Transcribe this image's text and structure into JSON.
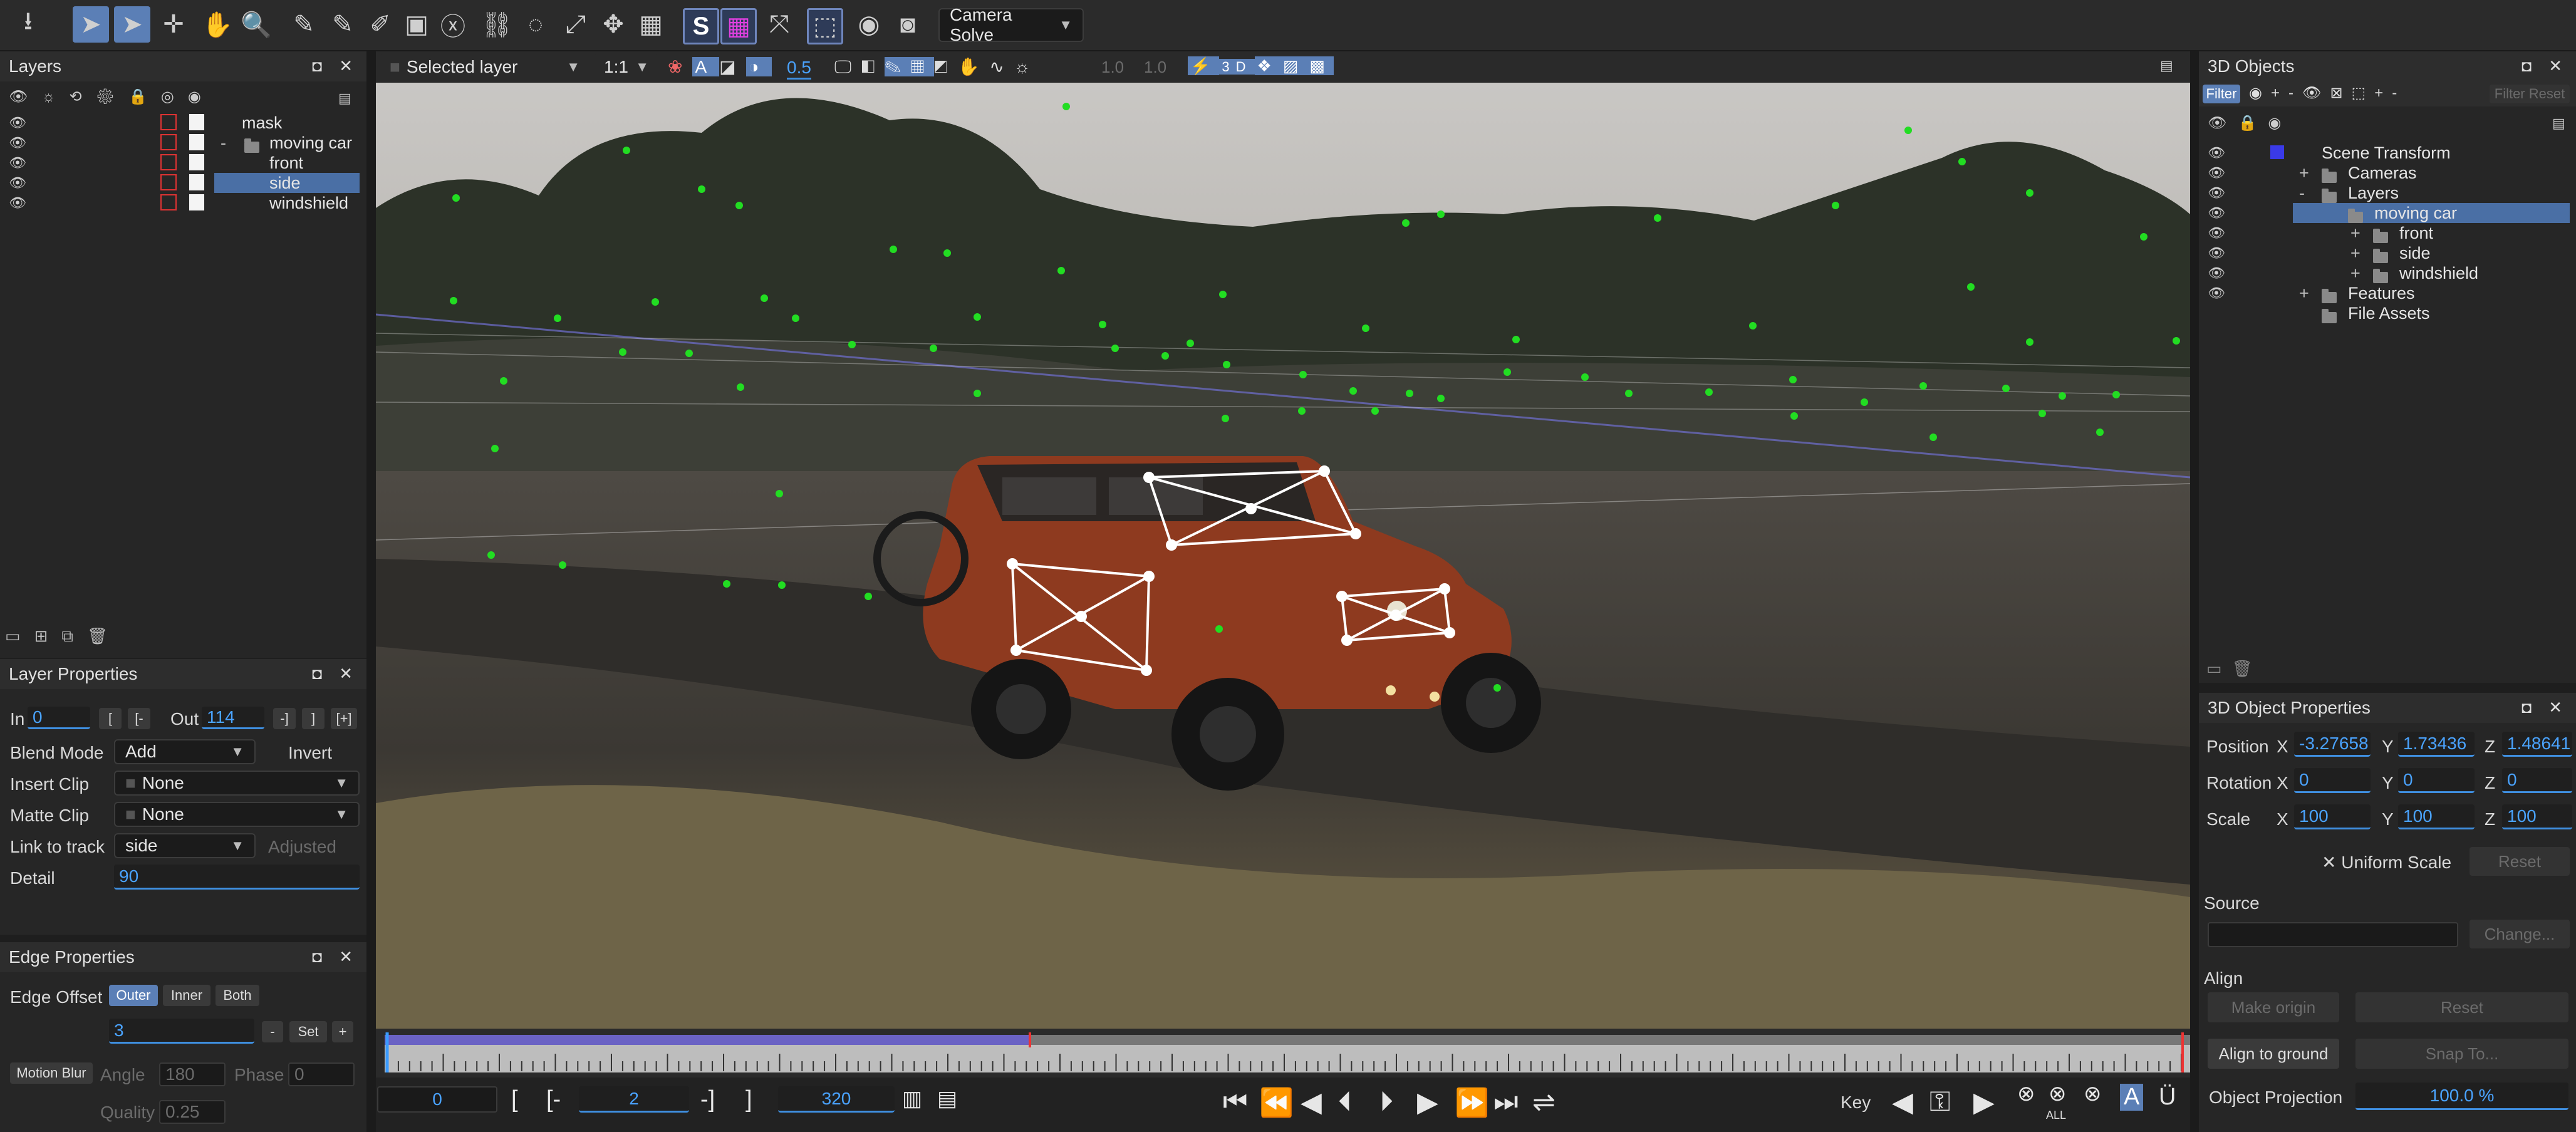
{
  "toolbar": {
    "camera_solve_label": "Camera Solve",
    "s_label": "S"
  },
  "viewer_toolbar": {
    "layer_select": "Selected layer",
    "zoom": "1:1",
    "opacity_value": "0.5",
    "exposure_a": "1.0",
    "exposure_b": "1.0",
    "mode_3d": "3D"
  },
  "layers_panel": {
    "title": "Layers",
    "layers": [
      {
        "name": "mask",
        "indent": 0
      },
      {
        "name": "moving car",
        "indent": 1,
        "folder": true
      },
      {
        "name": "front",
        "indent": 2
      },
      {
        "name": "side",
        "indent": 2,
        "selected": true
      },
      {
        "name": "windshield",
        "indent": 2
      }
    ]
  },
  "layer_properties": {
    "title": "Layer Properties",
    "in_label": "In",
    "in_value": "0",
    "out_label": "Out",
    "out_value": "114",
    "blend_mode_label": "Blend Mode",
    "blend_mode_value": "Add",
    "invert_label": "Invert",
    "insert_clip_label": "Insert Clip",
    "insert_clip_value": "None",
    "matte_clip_label": "Matte Clip",
    "matte_clip_value": "None",
    "link_to_track_label": "Link to track",
    "link_to_track_value": "side",
    "adjusted_label": "Adjusted",
    "detail_label": "Detail",
    "detail_value": "90"
  },
  "edge_properties": {
    "title": "Edge Properties",
    "edge_offset_label": "Edge Offset",
    "outer": "Outer",
    "inner": "Inner",
    "both": "Both",
    "offset_value": "3",
    "set_label": "Set",
    "motion_blur_label": "Motion Blur",
    "angle_label": "Angle",
    "angle_value": "180",
    "phase_label": "Phase",
    "phase_value": "0",
    "quality_label": "Quality",
    "quality_value": "0.25"
  },
  "objects_panel": {
    "title": "3D Objects",
    "filter_label": "Filter",
    "filter_reset_label": "Filter Reset",
    "tree": [
      {
        "name": "Scene Transform",
        "indent": 0
      },
      {
        "name": "Cameras",
        "indent": 1,
        "expander": "+"
      },
      {
        "name": "Layers",
        "indent": 1,
        "expander": "-"
      },
      {
        "name": "moving car",
        "indent": 2,
        "selected": true
      },
      {
        "name": "front",
        "indent": 3,
        "expander": "+"
      },
      {
        "name": "side",
        "indent": 3,
        "expander": "+"
      },
      {
        "name": "windshield",
        "indent": 3,
        "expander": "+"
      },
      {
        "name": "Features",
        "indent": 1,
        "expander": "+"
      },
      {
        "name": "File Assets",
        "indent": 1
      }
    ]
  },
  "object_properties": {
    "title": "3D Object Properties",
    "position_label": "Position",
    "rotation_label": "Rotation",
    "scale_label": "Scale",
    "position": {
      "x": "-3.27658",
      "y": "1.73436",
      "z": "1.48641"
    },
    "rotation": {
      "x": "0",
      "y": "0",
      "z": "0"
    },
    "scale": {
      "x": "100",
      "y": "100",
      "z": "100"
    },
    "uniform_scale_label": "Uniform Scale",
    "reset_label": "Reset",
    "source_label": "Source",
    "change_label": "Change...",
    "align_label": "Align",
    "make_origin_label": "Make origin",
    "align_reset_label": "Reset",
    "align_to_ground_label": "Align to ground",
    "snap_to_label": "Snap To...",
    "object_projection_label": "Object Projection",
    "object_projection_value": "100.0 %"
  },
  "transport": {
    "current_frame": "0",
    "in_frame": "2",
    "out_frame": "320",
    "key_label": "Key",
    "all_label": "ALL"
  },
  "colors": {
    "accent": "#5b7fb6",
    "selection": "#4a6fa5",
    "track_point": "#22dd22",
    "timeline_range": "#6a62c4"
  }
}
